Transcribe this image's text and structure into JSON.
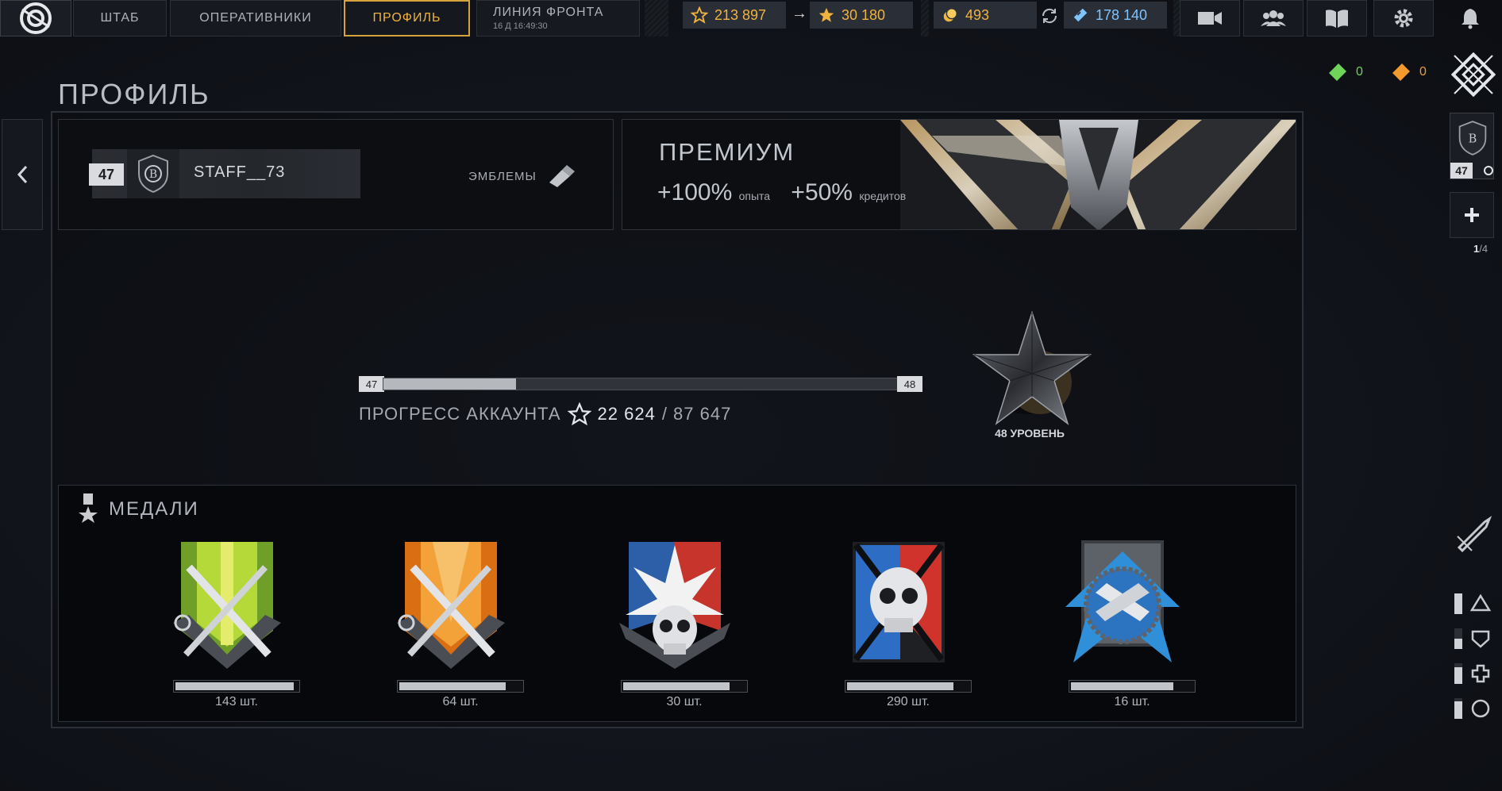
{
  "topbar": {
    "tabs": [
      {
        "label": "ШТАБ"
      },
      {
        "label": "ОПЕРАТИВНИКИ"
      },
      {
        "label": "ПРОФИЛЬ",
        "active": true
      },
      {
        "label": "ЛИНИЯ ФРОНТА",
        "sub": "16 Д 16:49:30"
      }
    ],
    "currencies": {
      "xp": "213 897",
      "stars": "30 180",
      "coins": "493",
      "credits": "178 140"
    },
    "icons": [
      "video-icon",
      "friends-icon",
      "book-icon",
      "gear-icon",
      "bell-icon"
    ]
  },
  "page": {
    "title": "ПРОФИЛЬ"
  },
  "profile": {
    "level": "47",
    "nickname": "STAFF__73",
    "emblems_label": "ЭМБЛЕМЫ"
  },
  "premium": {
    "title": "ПРЕМИУМ",
    "xp_bonus": "+100%",
    "xp_unit": "опыта",
    "credit_bonus": "+50%",
    "credit_unit": "кредитов"
  },
  "progress": {
    "from_level": "47",
    "to_level": "48",
    "label": "ПРОГРЕСС АККАУНТА",
    "current": "22 624",
    "max": "/ 87 647",
    "fraction": 0.258,
    "next_level_label": "48 УРОВЕНЬ"
  },
  "medals": {
    "title": "МЕДАЛИ",
    "items": [
      {
        "count": "143 шт.",
        "fill": 0.98,
        "kind": "medic-green"
      },
      {
        "count": "64 шт.",
        "fill": 0.88,
        "kind": "medic-orange"
      },
      {
        "count": "30 шт.",
        "fill": 0.88,
        "kind": "skull-red"
      },
      {
        "count": "290 шт.",
        "fill": 0.88,
        "kind": "skull-blue"
      },
      {
        "count": "16 шт.",
        "fill": 0.85,
        "kind": "handshake-blue"
      }
    ]
  },
  "side": {
    "tickets": {
      "green": "0",
      "orange": "0"
    },
    "party_level": "47",
    "party_current": "1",
    "party_total": "/4"
  },
  "colors": {
    "accent": "#f0b33f",
    "credits": "#7fc4ff",
    "green": "#6fd35a",
    "orange": "#f29a2e"
  }
}
